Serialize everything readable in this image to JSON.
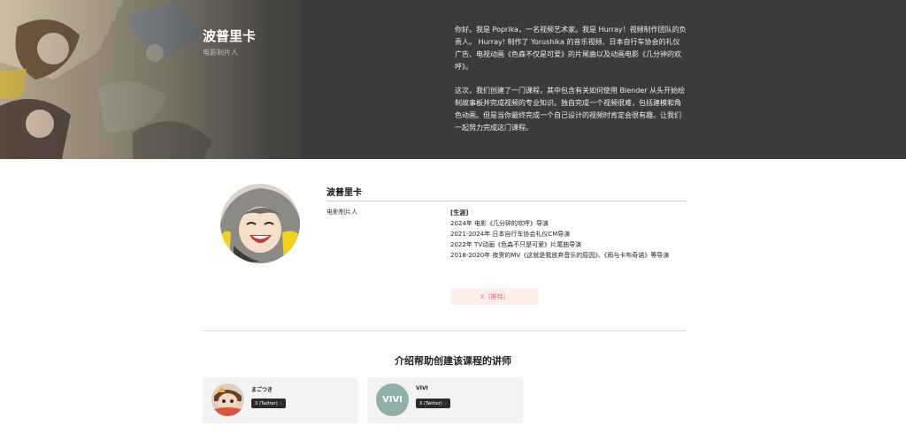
{
  "hero": {
    "name": "波普里卡",
    "role": "电影制片人",
    "bio": [
      "你好。我是 Poprika，一名视频艺术家。我是 Hurray！视频制作团队的负责人。 Hurray! 制作了 Yorushika 的音乐视频、日本自行车协会的礼仪广告、电视动画《色森不仅是可爱》的片尾曲以及动画电影《几分钟的欢呼》。",
      "这次，我们创建了一门课程，其中包含有关如何使用 Blender 从头开始绘制故事板并完成视频的专业知识。独自完成一个视频很难，包括建模和角色动画。但是当你最终完成一个自己设计的视频时肯定会很有趣。让我们一起努力完成这门课程。"
    ]
  },
  "profile": {
    "name": "波普里卡",
    "role": "电影制片人",
    "career_heading": "[生涯]",
    "career_items": [
      "2024年 电影《几分钟的欢呼》导演",
      "2021-2024年 日本自行车协会礼仪CM导演",
      "2022年 TV动画《色森不只是可爱》片尾曲导演",
      "2018-2020年 夜贺的MV《这就是我放弃音乐的原因》、《雨与卡布奇诺》等导演"
    ],
    "x_button_label": "X（推特）"
  },
  "instructors": {
    "title": "介绍帮助创建该课程的讲师",
    "cards": [
      {
        "name": "まごつき",
        "x_label": "X (Twitter)",
        "arrow": "›"
      },
      {
        "name": "VIVI",
        "avatar_text": "VIVI",
        "x_label": "X (Twitter)",
        "arrow": "›"
      }
    ]
  },
  "colors": {
    "hero_bg": "#3b3b39",
    "x_button_bg": "#fdeeec",
    "x_button_text": "#e46a5c",
    "vivi_avatar": "#8fb0a8"
  }
}
